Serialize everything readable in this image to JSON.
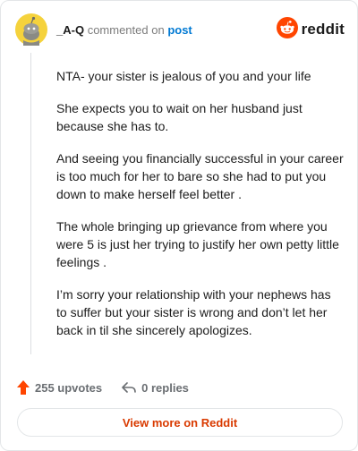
{
  "comment": {
    "author": "_A-Q",
    "action_text": "commented on",
    "post_link_text": "post",
    "paragraphs": [
      "NTA- your sister is jealous of you and your life",
      "She expects you to wait on her husband just because she has to.",
      "And seeing you financially successful in your career is too much for her to bare so she had to put you down to make herself feel better .",
      "The whole bringing up grievance from where you were 5 is just her trying to justify her own petty little feelings .",
      "I’m sorry your relationship with your nephews has to suffer but your sister is wrong and don’t let her back in til she sincerely apologizes."
    ]
  },
  "brand": {
    "wordmark": "reddit",
    "icon": "reddit-snoo-icon",
    "color": "#ff4500"
  },
  "avatar": {
    "icon": "snoo-avatar-icon",
    "bg_color": "#f5d23c"
  },
  "stats": {
    "upvotes_label": "255 upvotes",
    "replies_label": "0 replies",
    "upvote_icon": "upvote-arrow-icon",
    "reply_icon": "reply-arrow-icon",
    "upvote_color": "#ff4500"
  },
  "footer": {
    "view_more_label": "View more on Reddit",
    "accent_color": "#d93a00"
  }
}
